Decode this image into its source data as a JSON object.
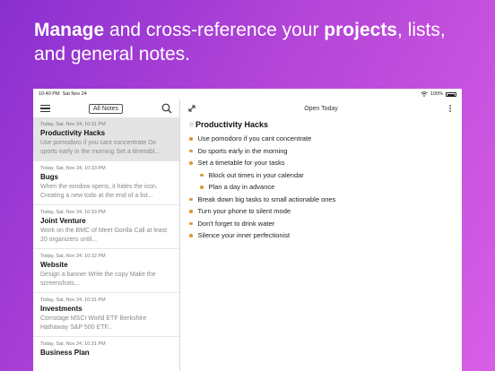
{
  "headline": {
    "p1": "Manage",
    "p2": " and cross-reference your ",
    "p3": "projects",
    "p4": ", lists, and general notes."
  },
  "statusbar": {
    "time": "10:40 PM",
    "date": "Sat Nov 24",
    "battery": "100%"
  },
  "sidebar": {
    "filter_label": "All Notes",
    "notes": [
      {
        "date": "Today, Sat, Nov 24, 10:31 PM",
        "title": "Productivity Hacks",
        "preview": "Use pomodoro if you cant concentrate Do sports early in the morning Set a timetabl..."
      },
      {
        "date": "Today, Sat, Nov 24, 10:33 PM",
        "title": "Bugs",
        "preview": "When the window opens, it hides the icon. Creating a new todo at the end of a list..."
      },
      {
        "date": "Today, Sat, Nov 24, 10:33 PM",
        "title": "Joint Venture",
        "preview": "Work on the BMC of Meet Gorilla Call at least 20 organizers until..."
      },
      {
        "date": "Today, Sat, Nov 24, 10:32 PM",
        "title": "Website",
        "preview": "Design a banner Write the copy Make the screenshots..."
      },
      {
        "date": "Today, Sat, Nov 24, 10:31 PM",
        "title": "Investments",
        "preview": "Comstage MSCI World ETF Berkshire Hathaway S&P 500 ETF..."
      },
      {
        "date": "Today, Sat, Nov 24, 10:31 PM",
        "title": "Business Plan",
        "preview": ""
      }
    ]
  },
  "main": {
    "toolbar_center": "Open Today",
    "doc_title_hash": "#",
    "doc_title": "Productivity Hacks",
    "items": [
      {
        "text": "Use pomodoro if you cant concentrate",
        "indent": false
      },
      {
        "text": "Do sports early in the morning",
        "indent": false
      },
      {
        "text": "Set a timetable for your tasks",
        "indent": false
      },
      {
        "text": "Block out times in your calendar",
        "indent": true
      },
      {
        "text": "Plan a day in advance",
        "indent": true
      },
      {
        "text": "Break down big tasks to small actionable ones",
        "indent": false
      },
      {
        "text": "Turn your phone to silent mode",
        "indent": false
      },
      {
        "text": "Don't forget to drink water",
        "indent": false
      },
      {
        "text": "Silence your inner perfectionist",
        "indent": false
      }
    ]
  },
  "icons": {
    "menu": "hamburger-icon",
    "search": "search-icon",
    "expand": "expand-icon",
    "more": "more-vertical-icon",
    "wifi": "wifi-icon",
    "battery": "battery-icon"
  },
  "colors": {
    "bullet": "#e0953a",
    "selected_row": "#e4e4e4",
    "bg_gradient_start": "#8a2fd0",
    "bg_gradient_end": "#d85ee6"
  }
}
